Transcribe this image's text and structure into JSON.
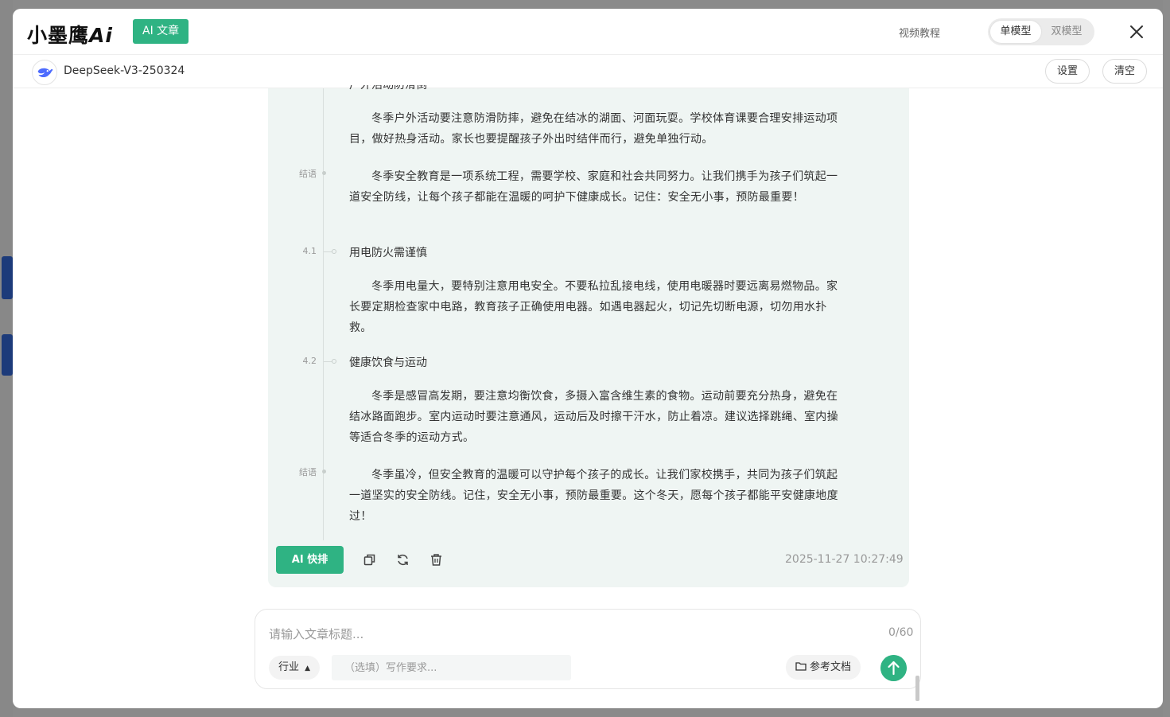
{
  "header": {
    "logo_text": "小墨鹰",
    "logo_ai": "Ai",
    "tag": "AI 文章",
    "video_tutorial": "视频教程",
    "model_toggle": {
      "single": "单模型",
      "dual": "双模型",
      "selected": "单模型"
    }
  },
  "subbar": {
    "model_name": "DeepSeek-V3-250324",
    "settings_label": "设置",
    "clear_label": "清空"
  },
  "article": {
    "paragraphs": [
      "冬季户外活动要注意防滑防摔，避免在结冰的湖面、河面玩耍。学校体育课要合理安排运动项目，做好热身活动。家长也要提醒孩子外出时结伴而行，避免单独行动。",
      "冬季安全教育是一项系统工程，需要学校、家庭和社会共同努力。让我们携手为孩子们筑起一道安全防线，让每个孩子都能在温暖的呵护下健康成长。记住：安全无小事，预防最重要！",
      "冬季用电量大，要特别注意用电安全。不要私拉乱接电线，使用电暖器时要远离易燃物品。家长要定期检查家中电路，教育孩子正确使用电器。如遇电器起火，切记先切断电源，切勿用水扑救。",
      "冬季是感冒高发期，要注意均衡饮食，多摄入富含维生素的食物。运动前要充分热身，避免在结冰路面跑步。室内运动时要注意通风，运动后及时擦干汗水，防止着凉。建议选择跳绳、室内操等适合冬季的运动方式。",
      "冬季虽冷，但安全教育的温暖可以守护每个孩子的成长。让我们家校携手，共同为孩子们筑起一道坚实的安全防线。记住，安全无小事，预防最重要。这个冬天，愿每个孩子都能平安健康地度过！"
    ],
    "headings": [
      "用电防火需谨慎",
      "健康饮食与运动"
    ],
    "timeline_labels": {
      "conclusion1": "结语",
      "s41": "4.1",
      "s42": "4.2",
      "conclusion2": "结语"
    },
    "cut_heading": "户外活动防滑倒"
  },
  "actions": {
    "ai_format": "AI 快排",
    "copy_icon": "copy-icon",
    "refresh_icon": "refresh-icon",
    "delete_icon": "trash-icon",
    "timestamp": "2025-11-27 10:27:49"
  },
  "composer": {
    "title_placeholder": "请输入文章标题...",
    "counter": "0/60",
    "industry_label": "行业",
    "requirement_placeholder": "（选填）写作要求...",
    "ref_doc_label": "参考文档"
  },
  "colors": {
    "accent": "#2fb383",
    "card_bg": "#eff5f3"
  }
}
